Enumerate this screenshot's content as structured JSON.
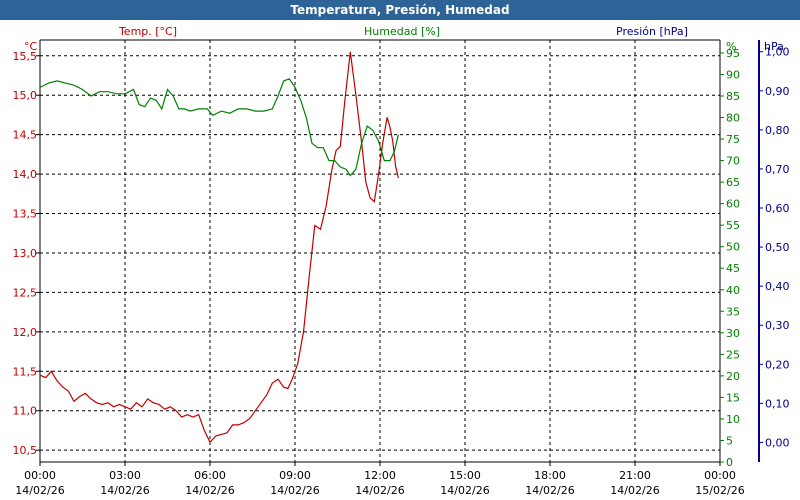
{
  "window": {
    "title": "Temperatura, Presión, Humedad"
  },
  "chart_data": {
    "type": "line",
    "title": "Temperatura, Presión, Humedad",
    "grid": true,
    "x_unit": "hours since 00:00 14/02/26",
    "x_ticks": [
      {
        "time": "00:00",
        "date": "14/02/26"
      },
      {
        "time": "03:00",
        "date": "14/02/26"
      },
      {
        "time": "06:00",
        "date": "14/02/26"
      },
      {
        "time": "09:00",
        "date": "14/02/26"
      },
      {
        "time": "12:00",
        "date": "14/02/26"
      },
      {
        "time": "15:00",
        "date": "14/02/26"
      },
      {
        "time": "18:00",
        "date": "14/02/26"
      },
      {
        "time": "21:00",
        "date": "14/02/26"
      },
      {
        "time": "00:00",
        "date": "15/02/26"
      }
    ],
    "axes": {
      "temp": {
        "unit": "°C",
        "min": 10.35,
        "max": 15.7,
        "ticks": [
          "10,5",
          "11,0",
          "11,5",
          "12,0",
          "12,5",
          "13,0",
          "13,5",
          "14,0",
          "14,5",
          "15,0",
          "15,5"
        ],
        "color": "#c00000"
      },
      "hum": {
        "unit": "%",
        "min": 0,
        "max": 98,
        "ticks": [
          "0",
          "5",
          "10",
          "15",
          "20",
          "25",
          "30",
          "35",
          "40",
          "45",
          "50",
          "55",
          "60",
          "65",
          "70",
          "75",
          "80",
          "85",
          "90",
          "95"
        ],
        "color": "#008000"
      },
      "pres": {
        "unit": "hPa",
        "min": -0.05,
        "max": 1.03,
        "ticks": [
          "0,00",
          "0,10",
          "0,20",
          "0,30",
          "0,40",
          "0,50",
          "0,60",
          "0,70",
          "0,80",
          "0,90",
          "1,00"
        ],
        "color": "#00008b"
      }
    },
    "series": [
      {
        "name": "Temp. [°C]",
        "axis": "temp",
        "color": "#c00000",
        "points": [
          [
            0.0,
            11.45
          ],
          [
            0.2,
            11.42
          ],
          [
            0.4,
            11.5
          ],
          [
            0.6,
            11.38
          ],
          [
            0.8,
            11.3
          ],
          [
            1.0,
            11.25
          ],
          [
            1.2,
            11.12
          ],
          [
            1.4,
            11.18
          ],
          [
            1.6,
            11.22
          ],
          [
            1.8,
            11.15
          ],
          [
            2.0,
            11.1
          ],
          [
            2.2,
            11.08
          ],
          [
            2.4,
            11.1
          ],
          [
            2.6,
            11.05
          ],
          [
            2.8,
            11.08
          ],
          [
            3.0,
            11.05
          ],
          [
            3.2,
            11.02
          ],
          [
            3.4,
            11.1
          ],
          [
            3.6,
            11.05
          ],
          [
            3.8,
            11.15
          ],
          [
            4.0,
            11.1
          ],
          [
            4.2,
            11.08
          ],
          [
            4.4,
            11.02
          ],
          [
            4.6,
            11.05
          ],
          [
            4.8,
            11.0
          ],
          [
            5.0,
            10.92
          ],
          [
            5.2,
            10.95
          ],
          [
            5.4,
            10.92
          ],
          [
            5.6,
            10.95
          ],
          [
            5.8,
            10.75
          ],
          [
            6.0,
            10.6
          ],
          [
            6.2,
            10.68
          ],
          [
            6.4,
            10.7
          ],
          [
            6.6,
            10.72
          ],
          [
            6.8,
            10.82
          ],
          [
            7.0,
            10.82
          ],
          [
            7.2,
            10.85
          ],
          [
            7.4,
            10.9
          ],
          [
            7.6,
            11.0
          ],
          [
            7.8,
            11.1
          ],
          [
            8.0,
            11.2
          ],
          [
            8.2,
            11.35
          ],
          [
            8.4,
            11.4
          ],
          [
            8.6,
            11.3
          ],
          [
            8.75,
            11.28
          ],
          [
            8.9,
            11.4
          ],
          [
            9.1,
            11.6
          ],
          [
            9.3,
            12.0
          ],
          [
            9.5,
            12.7
          ],
          [
            9.7,
            13.35
          ],
          [
            9.9,
            13.3
          ],
          [
            10.1,
            13.6
          ],
          [
            10.3,
            14.05
          ],
          [
            10.45,
            14.3
          ],
          [
            10.6,
            14.35
          ],
          [
            10.75,
            14.9
          ],
          [
            10.95,
            15.55
          ],
          [
            11.15,
            15.0
          ],
          [
            11.35,
            14.4
          ],
          [
            11.5,
            13.9
          ],
          [
            11.65,
            13.7
          ],
          [
            11.8,
            13.65
          ],
          [
            11.95,
            14.0
          ],
          [
            12.1,
            14.4
          ],
          [
            12.25,
            14.72
          ],
          [
            12.35,
            14.6
          ],
          [
            12.45,
            14.42
          ],
          [
            12.55,
            14.1
          ],
          [
            12.65,
            13.95
          ]
        ]
      },
      {
        "name": "Humedad [%]",
        "axis": "hum",
        "color": "#008000",
        "points": [
          [
            0.0,
            87.0
          ],
          [
            0.3,
            88.0
          ],
          [
            0.6,
            88.5
          ],
          [
            0.9,
            88.0
          ],
          [
            1.2,
            87.5
          ],
          [
            1.5,
            86.5
          ],
          [
            1.8,
            85.0
          ],
          [
            2.1,
            86.0
          ],
          [
            2.4,
            86.0
          ],
          [
            2.7,
            85.5
          ],
          [
            3.0,
            85.5
          ],
          [
            3.3,
            86.5
          ],
          [
            3.5,
            83.0
          ],
          [
            3.7,
            82.5
          ],
          [
            3.9,
            84.5
          ],
          [
            4.1,
            84.0
          ],
          [
            4.3,
            82.0
          ],
          [
            4.5,
            86.5
          ],
          [
            4.7,
            85.0
          ],
          [
            4.9,
            82.0
          ],
          [
            5.1,
            82.0
          ],
          [
            5.3,
            81.5
          ],
          [
            5.6,
            82.0
          ],
          [
            5.9,
            82.0
          ],
          [
            6.1,
            80.5
          ],
          [
            6.4,
            81.5
          ],
          [
            6.7,
            81.0
          ],
          [
            7.0,
            82.0
          ],
          [
            7.3,
            82.0
          ],
          [
            7.6,
            81.5
          ],
          [
            7.9,
            81.5
          ],
          [
            8.2,
            82.0
          ],
          [
            8.4,
            85.0
          ],
          [
            8.6,
            88.5
          ],
          [
            8.8,
            89.0
          ],
          [
            9.0,
            87.0
          ],
          [
            9.2,
            84.0
          ],
          [
            9.4,
            80.0
          ],
          [
            9.6,
            74.0
          ],
          [
            9.8,
            73.0
          ],
          [
            10.0,
            73.0
          ],
          [
            10.2,
            70.0
          ],
          [
            10.4,
            70.0
          ],
          [
            10.6,
            68.5
          ],
          [
            10.8,
            68.0
          ],
          [
            10.95,
            66.5
          ],
          [
            11.15,
            68.0
          ],
          [
            11.35,
            74.0
          ],
          [
            11.55,
            78.0
          ],
          [
            11.75,
            77.0
          ],
          [
            11.95,
            74.5
          ],
          [
            12.15,
            70.0
          ],
          [
            12.35,
            70.0
          ],
          [
            12.5,
            72.0
          ],
          [
            12.65,
            76.0
          ]
        ]
      },
      {
        "name": "Presión [hPa]",
        "axis": "pres",
        "color": "#00008b",
        "points": []
      }
    ]
  }
}
